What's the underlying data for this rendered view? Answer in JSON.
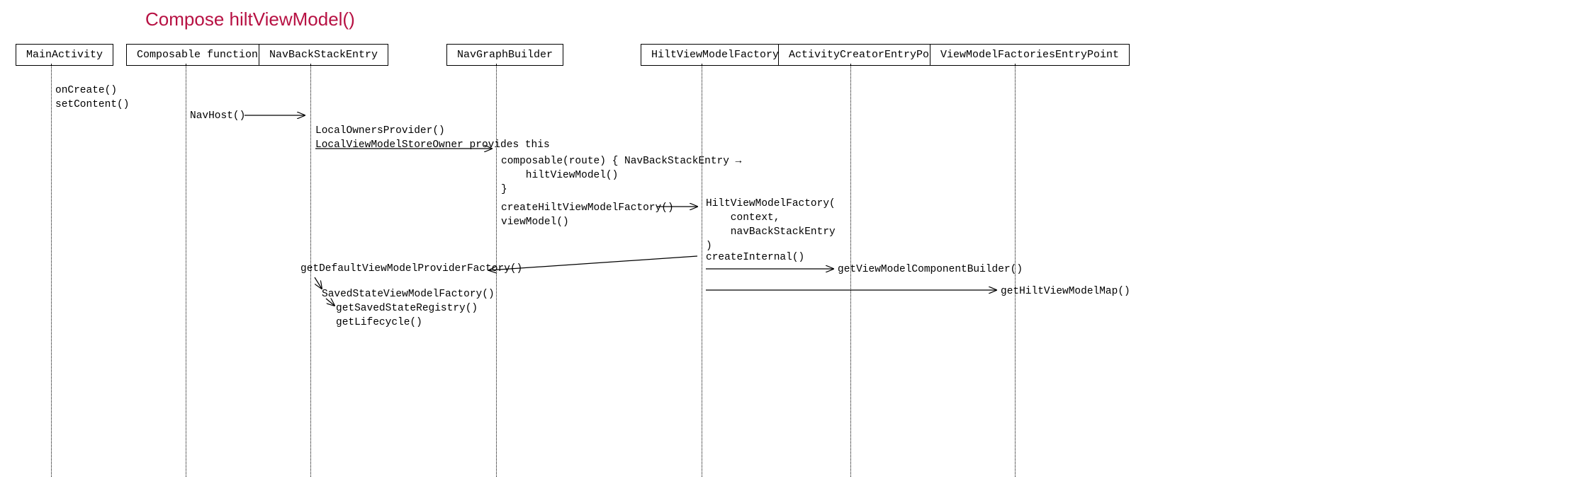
{
  "title": "Compose hiltViewModel()",
  "lifelines": {
    "main": "MainActivity",
    "composable": "Composable functions",
    "navback": "NavBackStackEntry",
    "navgraph": "NavGraphBuilder",
    "hiltvm": "HiltViewModelFactory",
    "actentry": "ActivityCreatorEntryPoint",
    "vmentry": "ViewModelFactoriesEntryPoint"
  },
  "messages": {
    "onCreate": "onCreate()",
    "setContent": "setContent()",
    "navHost": "NavHost()",
    "localOwners": "LocalOwnersProvider()",
    "localVmStore": "LocalViewModelStoreOwner provides this",
    "composableBlock": "composable(route) { NavBackStackEntry →\n    hiltViewModel()\n}",
    "createHiltFactory": "createHiltViewModelFactory()",
    "viewModel": "viewModel()",
    "hiltCtor": "HiltViewModelFactory(\n    context,\n    navBackStackEntry\n)",
    "createInternal": "createInternal()",
    "getVmCompBuilder": "getViewModelComponentBuilder()",
    "getHiltVmMap": "getHiltViewModelMap()",
    "getDefaultFactory": "getDefaultViewModelProviderFactory()",
    "savedStateFactory": "SavedStateViewModelFactory()",
    "getSavedStateReg": "getSavedStateRegistry()",
    "getLifecycle": "getLifecycle()"
  }
}
